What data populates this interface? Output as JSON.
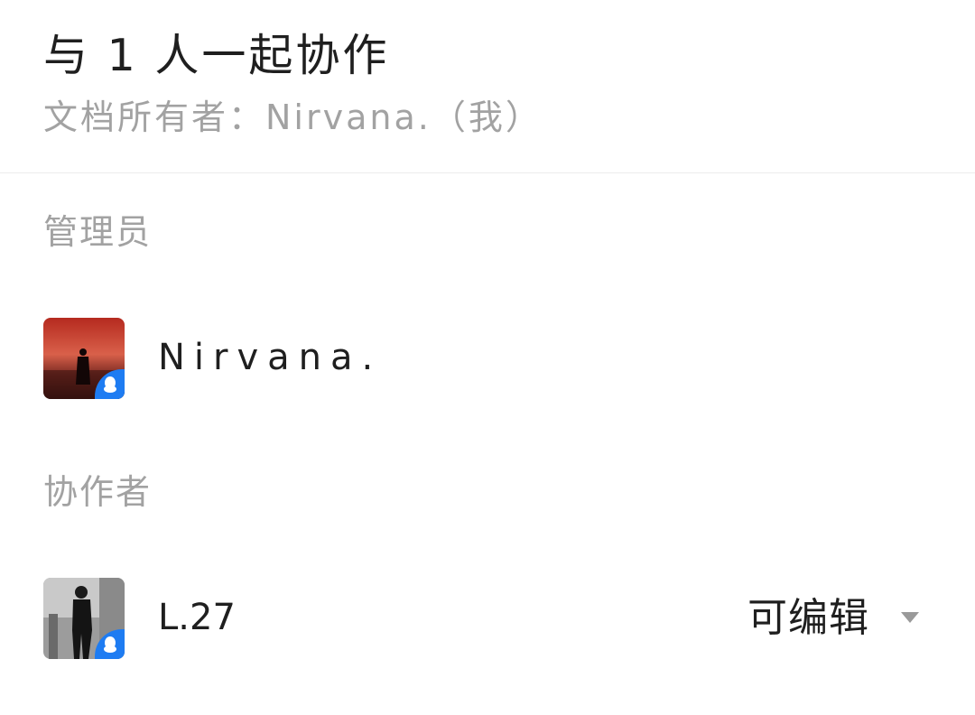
{
  "header": {
    "title": "与 1 人一起协作",
    "owner_line": "文档所有者：Nirvana.（我）"
  },
  "sections": {
    "admins_label": "管理员",
    "collaborators_label": "协作者"
  },
  "admins": [
    {
      "name": "Nirvana.",
      "avatar_icon": "qq-avatar-icon",
      "badge_icon": "qq-penguin-icon"
    }
  ],
  "collaborators": [
    {
      "name": "L.27",
      "avatar_icon": "qq-avatar-icon",
      "badge_icon": "qq-penguin-icon",
      "permission": "可编辑"
    }
  ],
  "colors": {
    "badge": "#1e7cf2",
    "muted_text": "#a2a2a2",
    "primary_text": "#1f1f1f",
    "divider": "#ececec"
  }
}
